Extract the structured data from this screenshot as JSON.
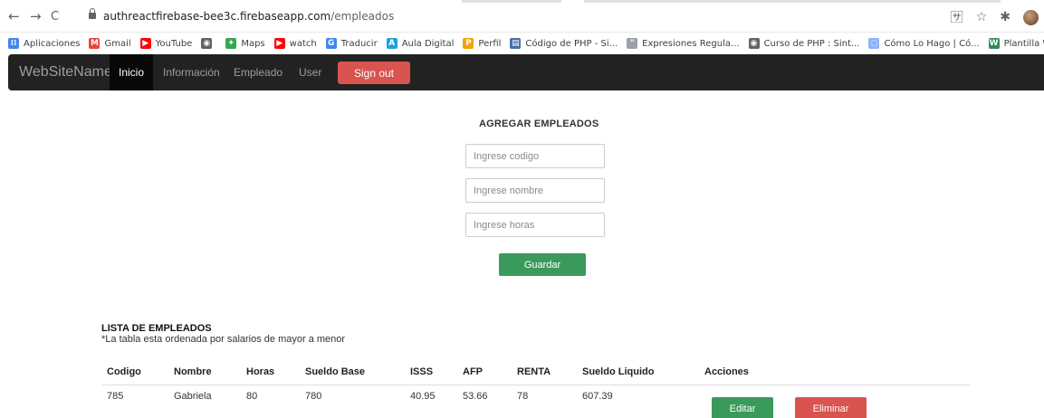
{
  "browser": {
    "url_host": "authreactfirebase-bee3c.firebaseapp.com",
    "url_path": "/empleados",
    "back_icon": "←",
    "forward_icon": "→",
    "reload_icon": "C",
    "translate_icon": "🈂",
    "star_icon": "☆",
    "extensions_icon": "✱"
  },
  "bookmarks": [
    {
      "label": "Aplicaciones",
      "icon": "apps-grid-icon",
      "glyph": "⁞⁞",
      "color": "#4285f4"
    },
    {
      "label": "Gmail",
      "icon": "gmail-icon",
      "glyph": "M",
      "color": "#ea4335"
    },
    {
      "label": "YouTube",
      "icon": "youtube-icon",
      "glyph": "▶",
      "color": "#ff0000"
    },
    {
      "label": "",
      "icon": "globe-icon",
      "glyph": "◉",
      "color": "#5f6368"
    },
    {
      "label": "Maps",
      "icon": "maps-icon",
      "glyph": "✦",
      "color": "#34a853"
    },
    {
      "label": "watch",
      "icon": "youtube-icon",
      "glyph": "▶",
      "color": "#ff0000"
    },
    {
      "label": "Traducir",
      "icon": "translate-icon",
      "glyph": "G",
      "color": "#4285f4"
    },
    {
      "label": "Aula Digital",
      "icon": "aula-icon",
      "glyph": "A",
      "color": "#1aa3d9"
    },
    {
      "label": "Perfil",
      "icon": "profile-icon",
      "glyph": "P",
      "color": "#f4a300"
    },
    {
      "label": "Código de PHP - Si...",
      "icon": "page-icon",
      "glyph": "▤",
      "color": "#4a6fa5"
    },
    {
      "label": "Expresiones Regula...",
      "icon": "regex-icon",
      "glyph": "\"",
      "color": "#9aa0a6"
    },
    {
      "label": "Curso de PHP : Sint...",
      "icon": "globe-icon",
      "glyph": "◉",
      "color": "#5f6368"
    },
    {
      "label": "Cómo Lo Hago | Có...",
      "icon": "loading-icon",
      "glyph": "◌",
      "color": "#8ab4f8"
    },
    {
      "label": "Plantilla Web Simpl...",
      "icon": "template-icon",
      "glyph": "W",
      "color": "#2e8b57"
    }
  ],
  "navbar": {
    "brand": "WebSiteName",
    "items": [
      {
        "label": "Inicio",
        "active": true
      },
      {
        "label": "Información",
        "active": false
      },
      {
        "label": "Empleado",
        "active": false
      },
      {
        "label": "User",
        "active": false
      }
    ],
    "signout_label": "Sign out",
    "colors": {
      "bg": "#222222",
      "active_bg": "#080808",
      "danger": "#d9534f"
    }
  },
  "form": {
    "title": "AGREGAR EMPLEADOS",
    "codigo": {
      "placeholder": "Ingrese codigo",
      "value": ""
    },
    "nombre": {
      "placeholder": "Ingrese nombre",
      "value": ""
    },
    "horas": {
      "placeholder": "Ingrese horas",
      "value": ""
    },
    "submit_label": "Guardar",
    "submit_color": "#3a9a5c"
  },
  "list": {
    "title": "LISTA DE EMPLEADOS",
    "note": "*La tabla esta ordenada por salarios de mayor a menor",
    "columns": [
      "Codigo",
      "Nombre",
      "Horas",
      "Sueldo Base",
      "ISSS",
      "AFP",
      "RENTA",
      "Sueldo Liquido",
      "Acciones"
    ],
    "rows": [
      {
        "codigo": "785",
        "nombre": "Gabriela",
        "horas": "80",
        "sueldo_base": "780",
        "isss": "40.95",
        "afp": "53.66",
        "renta": "78",
        "sueldo_liquido": "607.39",
        "edit_label": "Editar",
        "delete_label": "Eliminar"
      }
    ]
  }
}
